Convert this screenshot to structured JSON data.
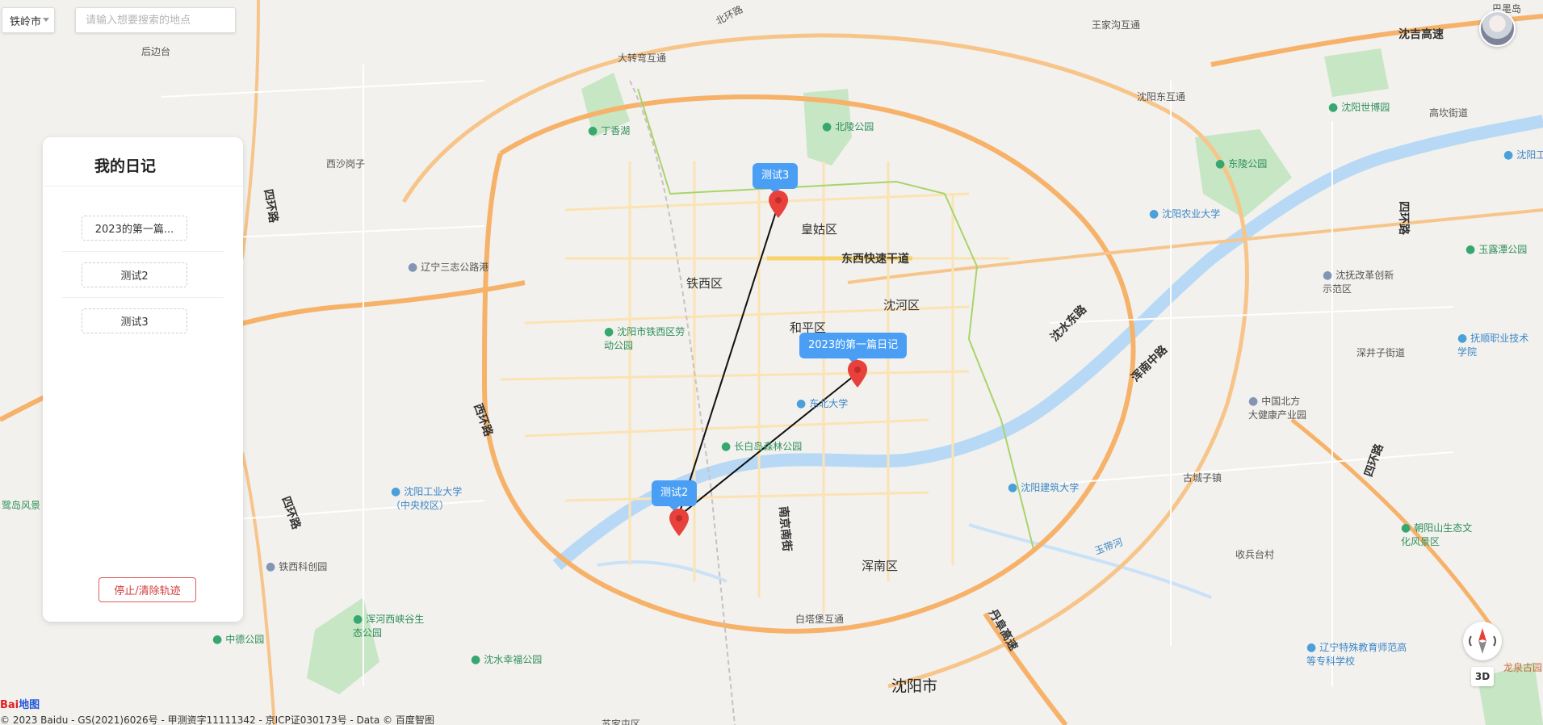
{
  "toolbar": {
    "city": "铁岭市",
    "search_placeholder": "请输入想要搜索的地点"
  },
  "panel": {
    "title": "我的日记",
    "items": [
      {
        "label": "2023的第一篇..."
      },
      {
        "label": "测试2"
      },
      {
        "label": "测试3"
      }
    ],
    "stop_button": "停止/清除轨迹"
  },
  "markers": [
    {
      "label": "测试3"
    },
    {
      "label": "2023的第一篇日记"
    },
    {
      "label": "测试2"
    }
  ],
  "map_labels": {
    "beihuanlu": "北环路",
    "dazhuanwan": "大转弯互通",
    "houjiatai": "后边台",
    "dingxianghu": "丁香湖",
    "beilinggongyuan": "北陵公园",
    "wangjiagou": "王家沟互通",
    "shenyangdongjiao": "沈阳东互通",
    "shenjigaosu": "沈吉高速",
    "shenyangshibo": "沈阳世博园",
    "gaokanjie": "高坎街道",
    "donglinggongyuan": "东陵公园",
    "shenyanggongye": "沈阳工学院",
    "xishayaozi": "西沙岗子",
    "sihuanlu_w": "四环路",
    "huanggu": "皇姑区",
    "dongxi": "东西快速干道",
    "nongye": "沈阳农业大学",
    "yulu": "玉露潭公园",
    "sihuanlu_e": "四环路",
    "liaoning": "辽宁三志公路港",
    "tiexiqu": "铁西区",
    "shenhequ": "沈河区",
    "heping": "和平区",
    "shenfu": "沈抚改革创新示范区",
    "shenshuidonglu": "沈水东路",
    "hunnan_zhonglu": "浑南中路",
    "laodong": "沈阳市铁西区劳动公园",
    "xinjing": "深井子街道",
    "fushunzhiye": "抚顺职业技术学院",
    "dongbeidaxue": "东北大学",
    "xihuanlu": "西环路",
    "zhongguobeifang": "中国北方大健康产业园",
    "changbaidao": "长白岛森林公园",
    "yinghuanlu": "四环路",
    "jianzhu": "沈阳建筑大学",
    "gongyedaxue": "沈阳工业大学（中央校区）",
    "guchengzi": "古城子镇",
    "nanjingnanjie": "南京南街",
    "sihuanlu_sw": "四环路",
    "yudaihe": "玉带河",
    "shouyetai": "收兵台村",
    "chaoyangshan": "朝阳山生态文化风景区",
    "tiexikechuang": "铁西科创园",
    "hunnan": "浑南区",
    "shenhexixiagu": "浑河西峡谷生态公园",
    "zhongde": "中德公园",
    "baitapu": "白塔堡互通",
    "danfu": "丹阜高速",
    "shenshuixingfu": "沈水幸福公园",
    "teshujiaoyu": "辽宁特殊教育师范高等专科学校",
    "longquan": "龙泉古园",
    "shenyangshi": "沈阳市",
    "sujiatun": "苏家屯区",
    "baqiaodao": "巴墨岛",
    "luwei": "鹭岛风景"
  },
  "controls": {
    "btn3d": "3D"
  },
  "footer": {
    "logo_a": "Bai",
    "logo_b": "地图",
    "copyright": "© 2023 Baidu - GS(2021)6026号 - 甲测资字11111342 - 京ICP证030173号 - Data © 百度智图"
  },
  "colors": {
    "marker_blue": "#4a9ff5",
    "marker_red": "#e8413c",
    "stop_red": "#d33b3b",
    "expressway": "#f7b26a",
    "river": "#b8d9f5",
    "park": "#b6dfb8"
  }
}
